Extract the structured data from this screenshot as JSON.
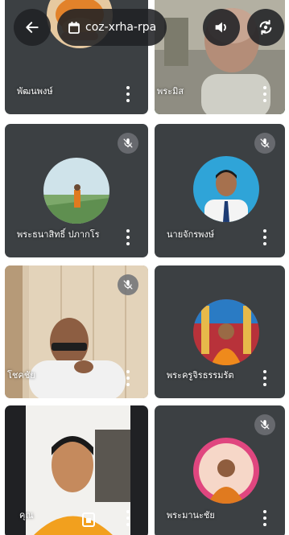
{
  "meeting": {
    "code": "coz-xrha-rpa",
    "icons": {
      "back": "arrow-left-icon",
      "calendar": "calendar-icon",
      "speaker": "speaker-volume-icon",
      "switch_camera": "switch-camera-icon",
      "muted": "mic-off-icon",
      "more": "more-vertical-icon"
    }
  },
  "participants": [
    {
      "id": "p1",
      "name": "พัฒนพงษ์",
      "muted": false
    },
    {
      "id": "p2",
      "name": "พระมิส",
      "muted": false,
      "active_speaker": true
    },
    {
      "id": "p3",
      "name": "พระธนาสิทธิ์ ปภากโร",
      "muted": true
    },
    {
      "id": "p4",
      "name": "นายจักรพงษ์",
      "muted": true
    },
    {
      "id": "p5",
      "name": "โชคชัย",
      "muted": true
    },
    {
      "id": "p6",
      "name": "พระครูจิรธรรมรัต",
      "muted": false
    },
    {
      "id": "p7",
      "name": "คุณ",
      "muted": false,
      "self": true
    },
    {
      "id": "p8",
      "name": "พระมานะชัย",
      "muted": true
    }
  ],
  "colors": {
    "tile_bg": "#3c4043",
    "active_border": "#1f6f2a",
    "overlay_btn": "#202124",
    "mute_badge": "#6e7175"
  }
}
